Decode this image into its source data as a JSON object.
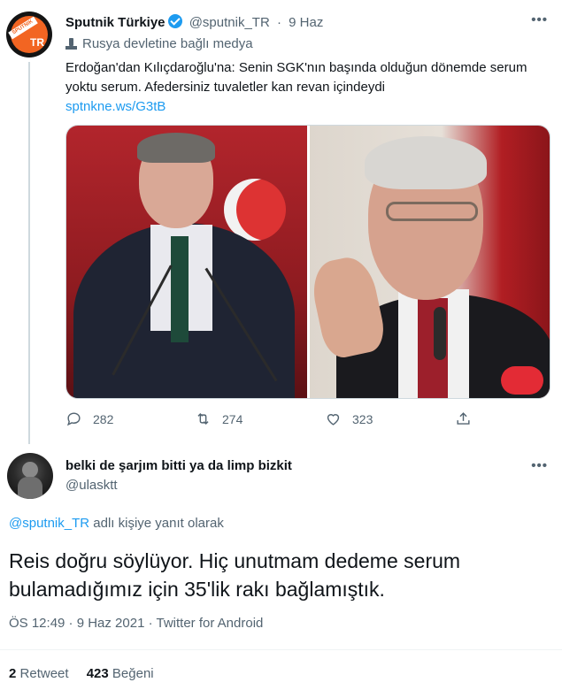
{
  "tweet1": {
    "display_name": "Sputnik Türkiye",
    "handle": "@sputnik_TR",
    "separator": "·",
    "date": "9 Haz",
    "label": "Rusya devletine bağlı medya",
    "text": "Erdoğan'dan Kılıçdaroğlu'na: Senin SGK'nın başında olduğun dönemde serum yoktu serum. Afedersiniz tuvaletler kan revan içindeydi",
    "link": "sptnkne.ws/G3tB",
    "avatar_text": "TR",
    "avatar_stripe": "SPUTNIK",
    "actions": {
      "replies": "282",
      "retweets": "274",
      "likes": "323"
    }
  },
  "tweet2": {
    "display_name": "belki de şarjım bitti ya da limp bizkit",
    "handle": "@ulasktt",
    "reply_mention": "@sputnik_TR",
    "reply_suffix": " adlı kişiye yanıt olarak",
    "text": "Reis doğru söylüyor. Hiç unutmam dedeme serum bulamadığımız için 35'lik rakı bağlamıştık.",
    "meta": "ÖS 12:49 · 9 Haz 2021 · Twitter for Android",
    "retweets_count": "2",
    "retweets_label": "Retweet",
    "likes_count": "423",
    "likes_label": "Beğeni"
  },
  "icons": {
    "more": "more-icon",
    "reply": "reply-icon",
    "retweet": "retweet-icon",
    "like": "heart-icon",
    "share": "share-icon",
    "verified": "verified-badge-icon",
    "label": "state-media-icon"
  },
  "colors": {
    "link": "#1d9bf0",
    "secondary": "#536471",
    "text": "#0f1419",
    "verified": "#1d9bf0"
  }
}
